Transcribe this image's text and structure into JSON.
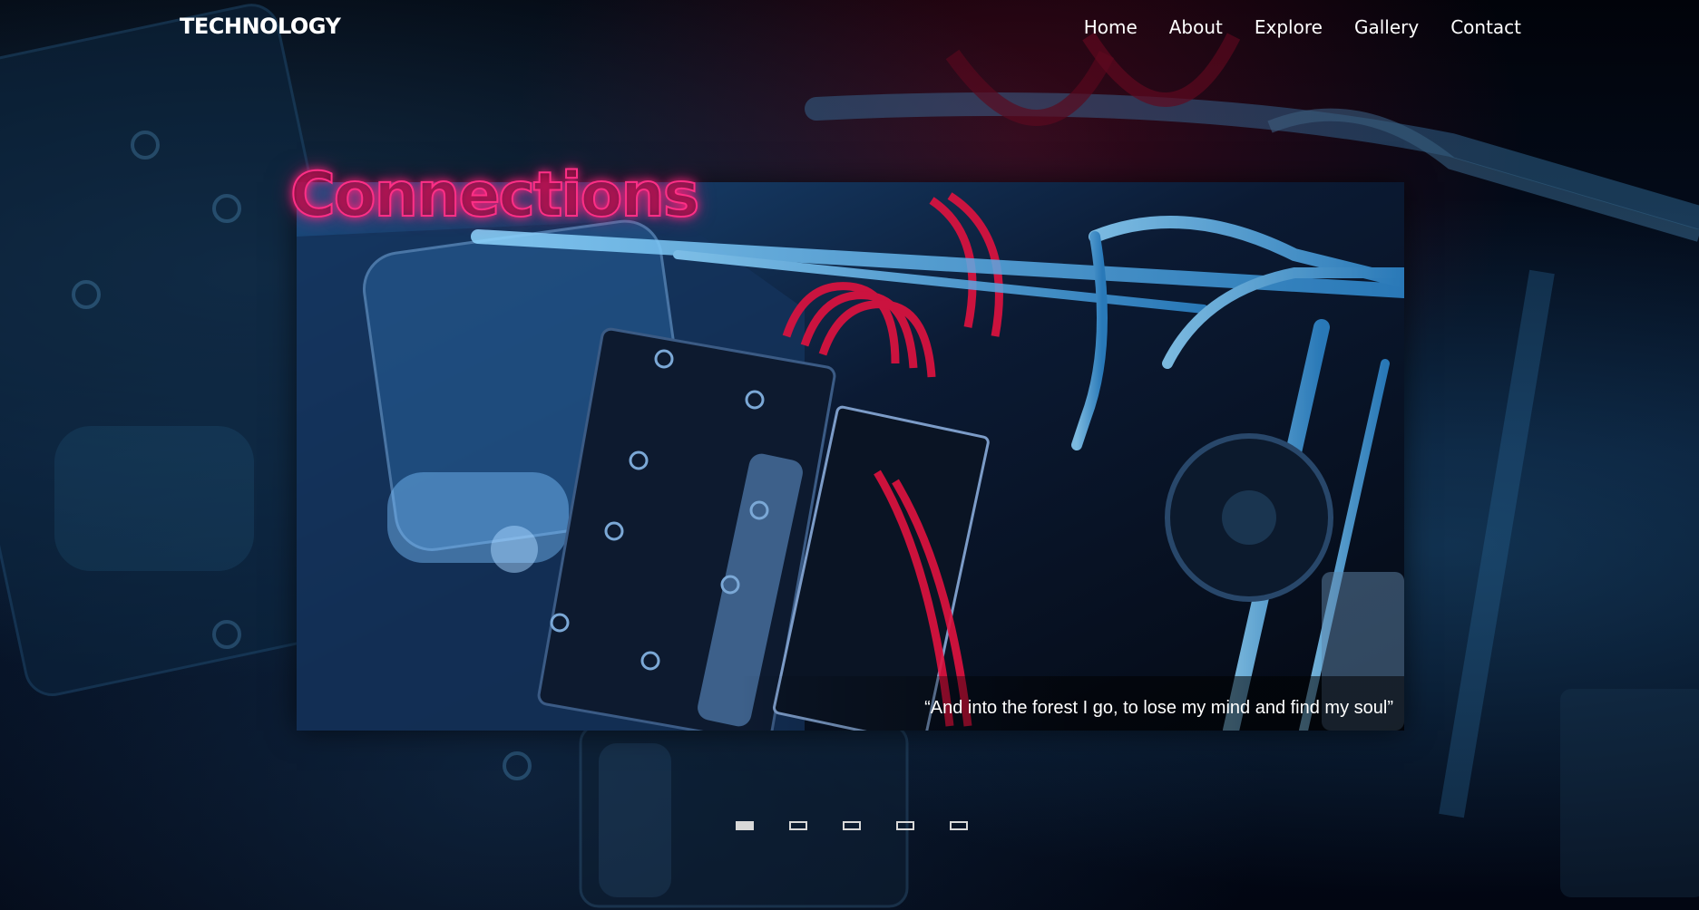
{
  "navbar": {
    "brand": "TECHNOLOGY",
    "links": [
      "Home",
      "About",
      "Explore",
      "Gallery",
      "Contact"
    ]
  },
  "slider": {
    "title": "Connections",
    "caption": "“And into the forest I go, to lose my mind and find my soul”",
    "slide_count": 5,
    "active_index": 0
  },
  "colors": {
    "title_neon": "#ff2f86",
    "text": "#ffffff",
    "dot": "#d8d8d8"
  }
}
